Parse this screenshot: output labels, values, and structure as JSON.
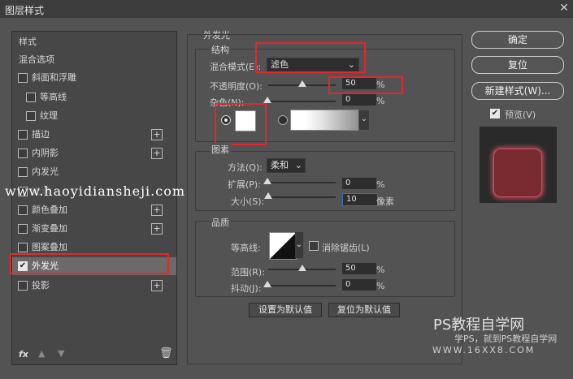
{
  "window": {
    "title": "图层样式",
    "close_icon": "close-icon"
  },
  "sidebar": {
    "items": [
      {
        "label": "样式",
        "checkbox": false,
        "plus": false
      },
      {
        "label": "混合选项",
        "checkbox": false,
        "plus": false
      },
      {
        "label": "斜面和浮雕",
        "checkbox": true,
        "plus": false
      },
      {
        "label": "等高线",
        "checkbox": true,
        "plus": false,
        "indent": true
      },
      {
        "label": "纹理",
        "checkbox": true,
        "plus": false,
        "indent": true
      },
      {
        "label": "描边",
        "checkbox": true,
        "plus": true
      },
      {
        "label": "内阴影",
        "checkbox": true,
        "plus": true
      },
      {
        "label": "内发光",
        "checkbox": true,
        "plus": false
      },
      {
        "label": "光泽",
        "checkbox": true,
        "plus": false
      },
      {
        "label": "颜色叠加",
        "checkbox": true,
        "plus": true
      },
      {
        "label": "渐变叠加",
        "checkbox": true,
        "plus": true
      },
      {
        "label": "图案叠加",
        "checkbox": true,
        "plus": false
      },
      {
        "label": "外发光",
        "checkbox": true,
        "checked": true,
        "plus": false,
        "selected": true
      },
      {
        "label": "投影",
        "checkbox": true,
        "plus": true
      }
    ],
    "footer": {
      "fx": "fx",
      "up_icon": "arrow-up-icon",
      "down_icon": "arrow-down-icon",
      "trash_icon": "trash-icon"
    }
  },
  "outer_glow": {
    "section_title": "外发光",
    "structure": {
      "title": "结构",
      "blend_mode_label": "混合模式(E):",
      "blend_mode_value": "滤色",
      "opacity_label": "不透明度(O):",
      "opacity_value": "50",
      "noise_label": "杂色(N):",
      "noise_value": "0",
      "percent": "%"
    },
    "elements": {
      "title": "图素",
      "technique_label": "方法(Q):",
      "technique_value": "柔和",
      "spread_label": "扩展(P):",
      "spread_value": "0",
      "size_label": "大小(S):",
      "size_value": "10",
      "size_unit": "像素",
      "percent": "%"
    },
    "quality": {
      "title": "品质",
      "contour_label": "等高线:",
      "antialias_label": "消除锯齿(L)",
      "range_label": "范围(R):",
      "range_value": "50",
      "jitter_label": "抖动(J):",
      "jitter_value": "0",
      "percent": "%"
    },
    "set_default": "设置为默认值",
    "reset_default": "复位为默认值"
  },
  "right": {
    "ok": "确定",
    "reset": "复位",
    "new_style": "新建样式(W)...",
    "preview_label": "预览(V)",
    "preview_color": "#8a2530"
  },
  "watermarks": {
    "url": "www.haoyidiansheji.com",
    "ps_title": "PS教程自学网",
    "ps_sub": "学PS，就到PS教程自学网",
    "ps_url": "WWW.16XX8.COM"
  }
}
